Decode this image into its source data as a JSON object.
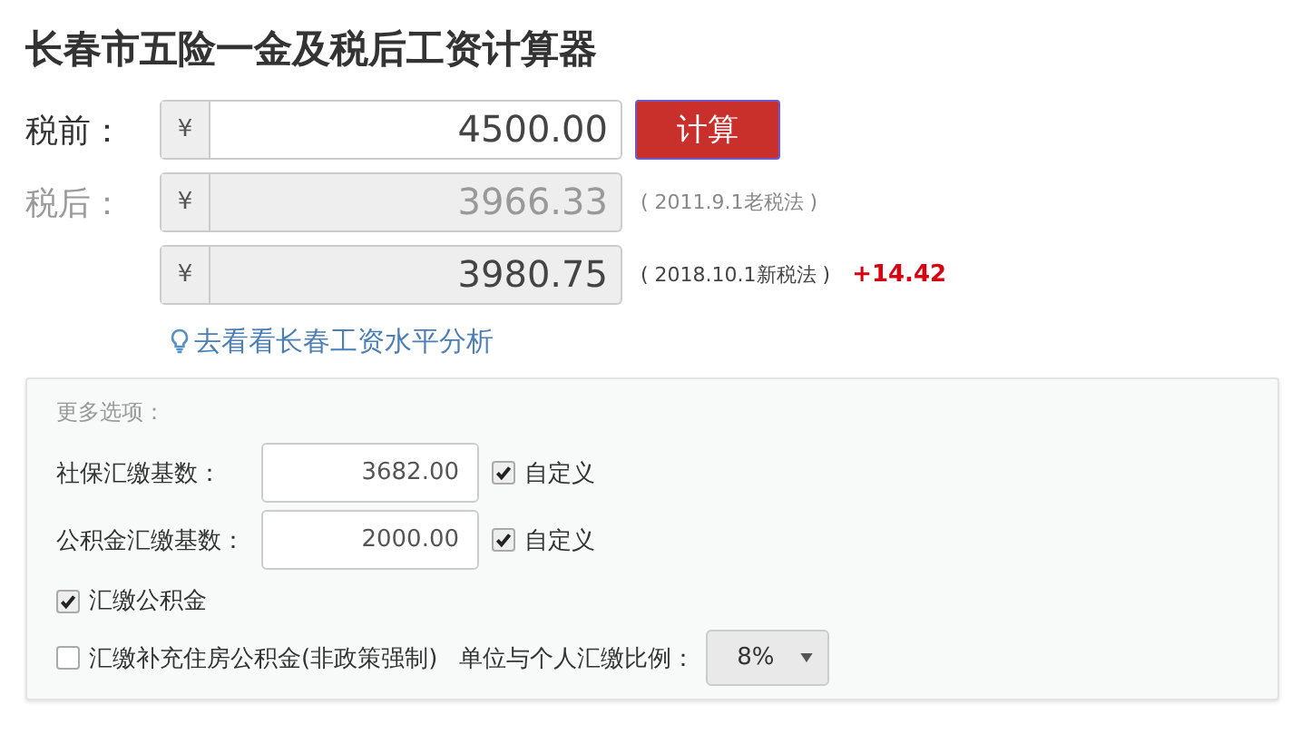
{
  "title": "长春市五险一金及税后工资计算器",
  "salary_rows": [
    {
      "label": "税前：",
      "currency": "¥",
      "value": "4500.00",
      "editable": true
    },
    {
      "label": "税后：",
      "currency": "¥",
      "value": "3966.33",
      "editable": false,
      "note": "( 2011.9.1老税法 )"
    },
    {
      "currency": "¥",
      "value": "3980.75",
      "editable": false,
      "note": "( 2018.10.1新税法 )",
      "diff": "+14.42"
    }
  ],
  "calculate_button": "计算",
  "analysis_link": "去看看长春工资水平分析",
  "options": {
    "heading": "更多选项：",
    "base_rows": [
      {
        "label": "社保汇缴基数：",
        "value": "3682.00",
        "custom_label": "自定义",
        "checked": true
      },
      {
        "label": "公积金汇缴基数：",
        "value": "2000.00",
        "custom_label": "自定义",
        "checked": true
      }
    ],
    "housing_fund": {
      "label": "汇缴公积金",
      "checked": true
    },
    "supplementary": {
      "label": "汇缴补充住房公积金(非政策强制)",
      "checked": false,
      "ratio_label": "单位与个人汇缴比例：",
      "ratio_value": "8%"
    }
  }
}
